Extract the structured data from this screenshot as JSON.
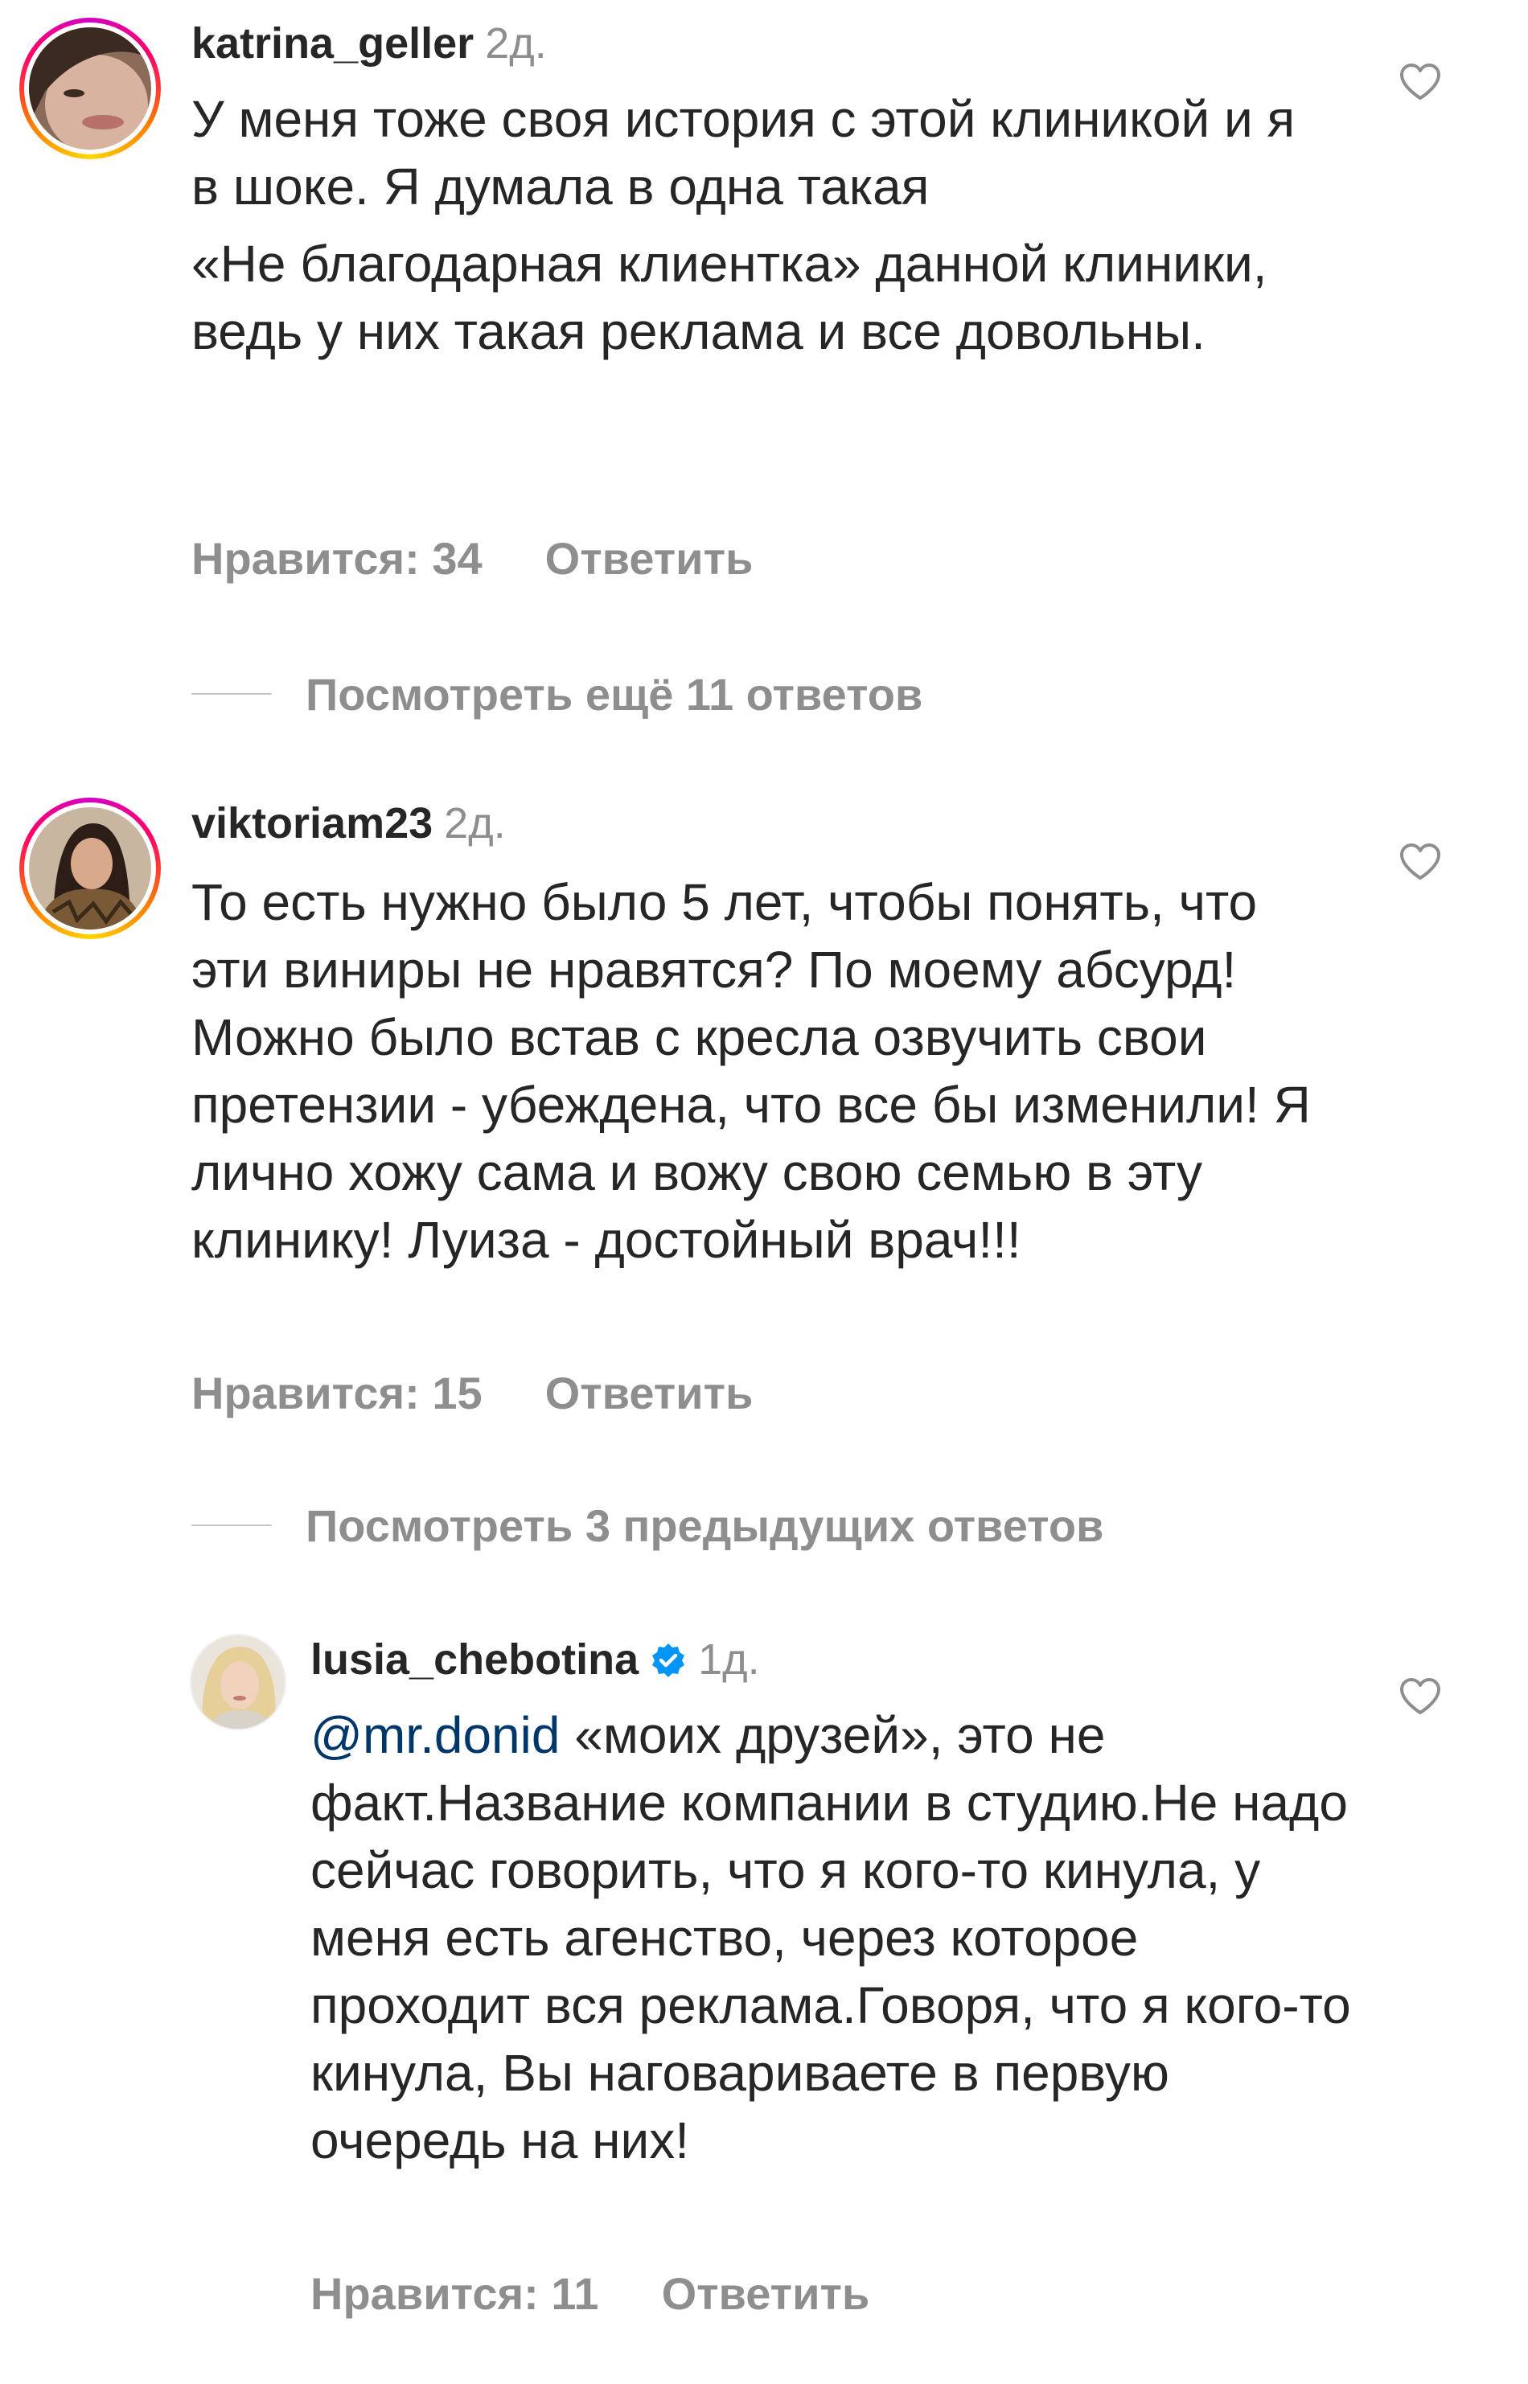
{
  "comments": [
    {
      "username": "katrina_geller",
      "time": "2д.",
      "text": [
        "У меня тоже своя история с этой клиникой и я в шоке. Я думала в одна такая",
        "«Не благодарная клиентка» данной клиники, ведь у них такая реклама и все довольны."
      ],
      "likes_label": "Нравится: 34",
      "reply_label": "Ответить",
      "view_more_label": "Посмотреть ещё 11 ответов"
    },
    {
      "username": "viktoriam23",
      "time": "2д.",
      "text": [
        "То есть нужно было 5 лет, чтобы понять, что эти виниры не нравятся? По моему абсурд! Можно было встав с кресла озвучить свои претензии - убеждена, что все бы изменили! Я лично хожу сама и вожу свою семью в эту клинику! Луиза - достойный врач!!!"
      ],
      "likes_label": "Нравится: 15",
      "reply_label": "Ответить",
      "view_more_label": "Посмотреть 3 предыдущих ответов"
    },
    {
      "username": "lusia_chebotina",
      "verified": true,
      "time": "1д.",
      "mention": "@mr.donid",
      "text": "«моих друзей», это не факт.Название компании в студию.Не надо сейчас говорить, что я кого-то кинула, у меня есть агенство, через которое проходит вся реклама.Говоря, что я кого-то кинула, Вы наговариваете в первую очередь на них!",
      "likes_label": "Нравится: 11",
      "reply_label": "Ответить"
    }
  ],
  "colors": {
    "text": "#262626",
    "secondary": "#8e8e8e",
    "mention": "#00376b",
    "verified": "#0095f6"
  },
  "icons": [
    "heart-icon",
    "verified-badge-icon"
  ]
}
